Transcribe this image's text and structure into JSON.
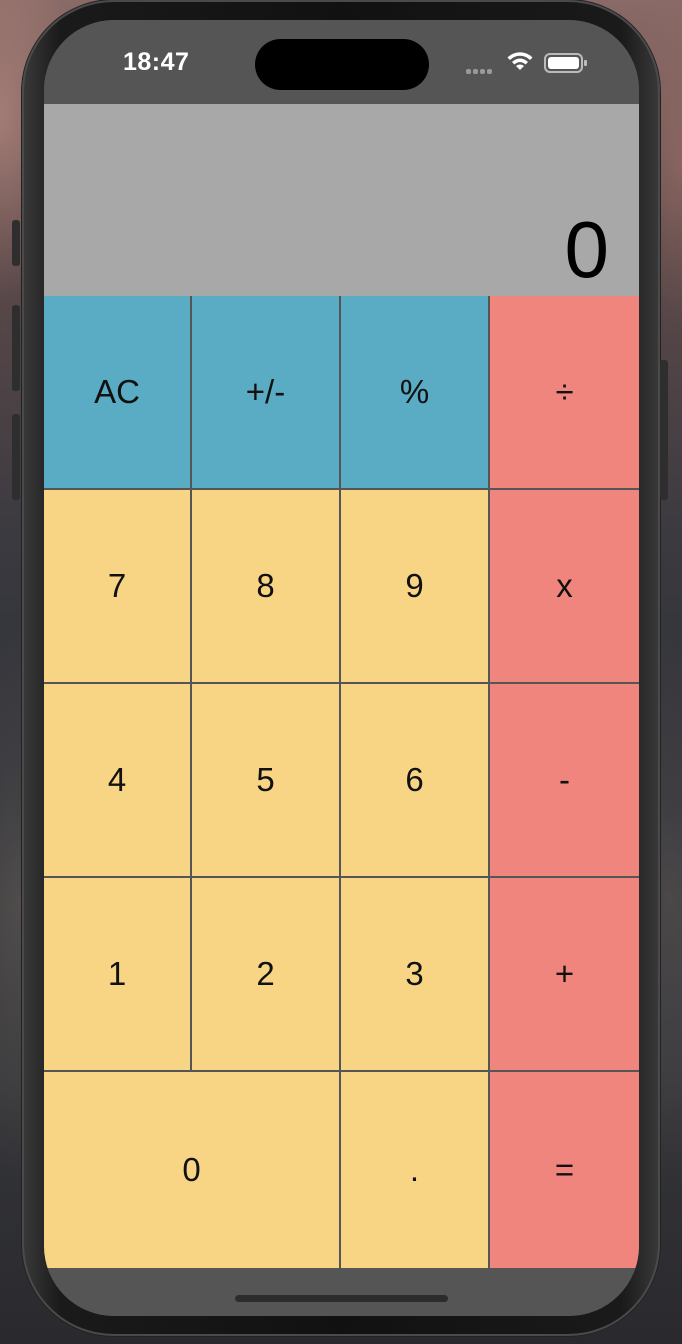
{
  "status_bar": {
    "time": "18:47",
    "signal_icon": "cellular-signal-icon",
    "wifi_icon": "wifi-icon",
    "battery_icon": "battery-icon"
  },
  "display": {
    "value": "0"
  },
  "keypad": {
    "rows": [
      [
        {
          "label": "AC",
          "kind": "function",
          "name": "all-clear-button"
        },
        {
          "label": "+/-",
          "kind": "function",
          "name": "toggle-sign-button"
        },
        {
          "label": "%",
          "kind": "function",
          "name": "percent-button"
        },
        {
          "label": "÷",
          "kind": "operator",
          "name": "divide-button"
        }
      ],
      [
        {
          "label": "7",
          "kind": "number",
          "name": "digit-7-button"
        },
        {
          "label": "8",
          "kind": "number",
          "name": "digit-8-button"
        },
        {
          "label": "9",
          "kind": "number",
          "name": "digit-9-button"
        },
        {
          "label": "x",
          "kind": "operator",
          "name": "multiply-button"
        }
      ],
      [
        {
          "label": "4",
          "kind": "number",
          "name": "digit-4-button"
        },
        {
          "label": "5",
          "kind": "number",
          "name": "digit-5-button"
        },
        {
          "label": "6",
          "kind": "number",
          "name": "digit-6-button"
        },
        {
          "label": "-",
          "kind": "operator",
          "name": "subtract-button"
        }
      ],
      [
        {
          "label": "1",
          "kind": "number",
          "name": "digit-1-button"
        },
        {
          "label": "2",
          "kind": "number",
          "name": "digit-2-button"
        },
        {
          "label": "3",
          "kind": "number",
          "name": "digit-3-button"
        },
        {
          "label": "+",
          "kind": "operator",
          "name": "add-button"
        }
      ],
      [
        {
          "label": "0",
          "kind": "number",
          "name": "digit-0-button"
        },
        {
          "label": ".",
          "kind": "number",
          "name": "decimal-button"
        },
        {
          "label": "=",
          "kind": "operator",
          "name": "equals-button"
        }
      ]
    ]
  },
  "colors": {
    "function_key": "#5aabc4",
    "operator_key": "#f0857d",
    "number_key": "#f8d585",
    "display_background": "#a8a8a8",
    "grid_lines": "#555555"
  }
}
